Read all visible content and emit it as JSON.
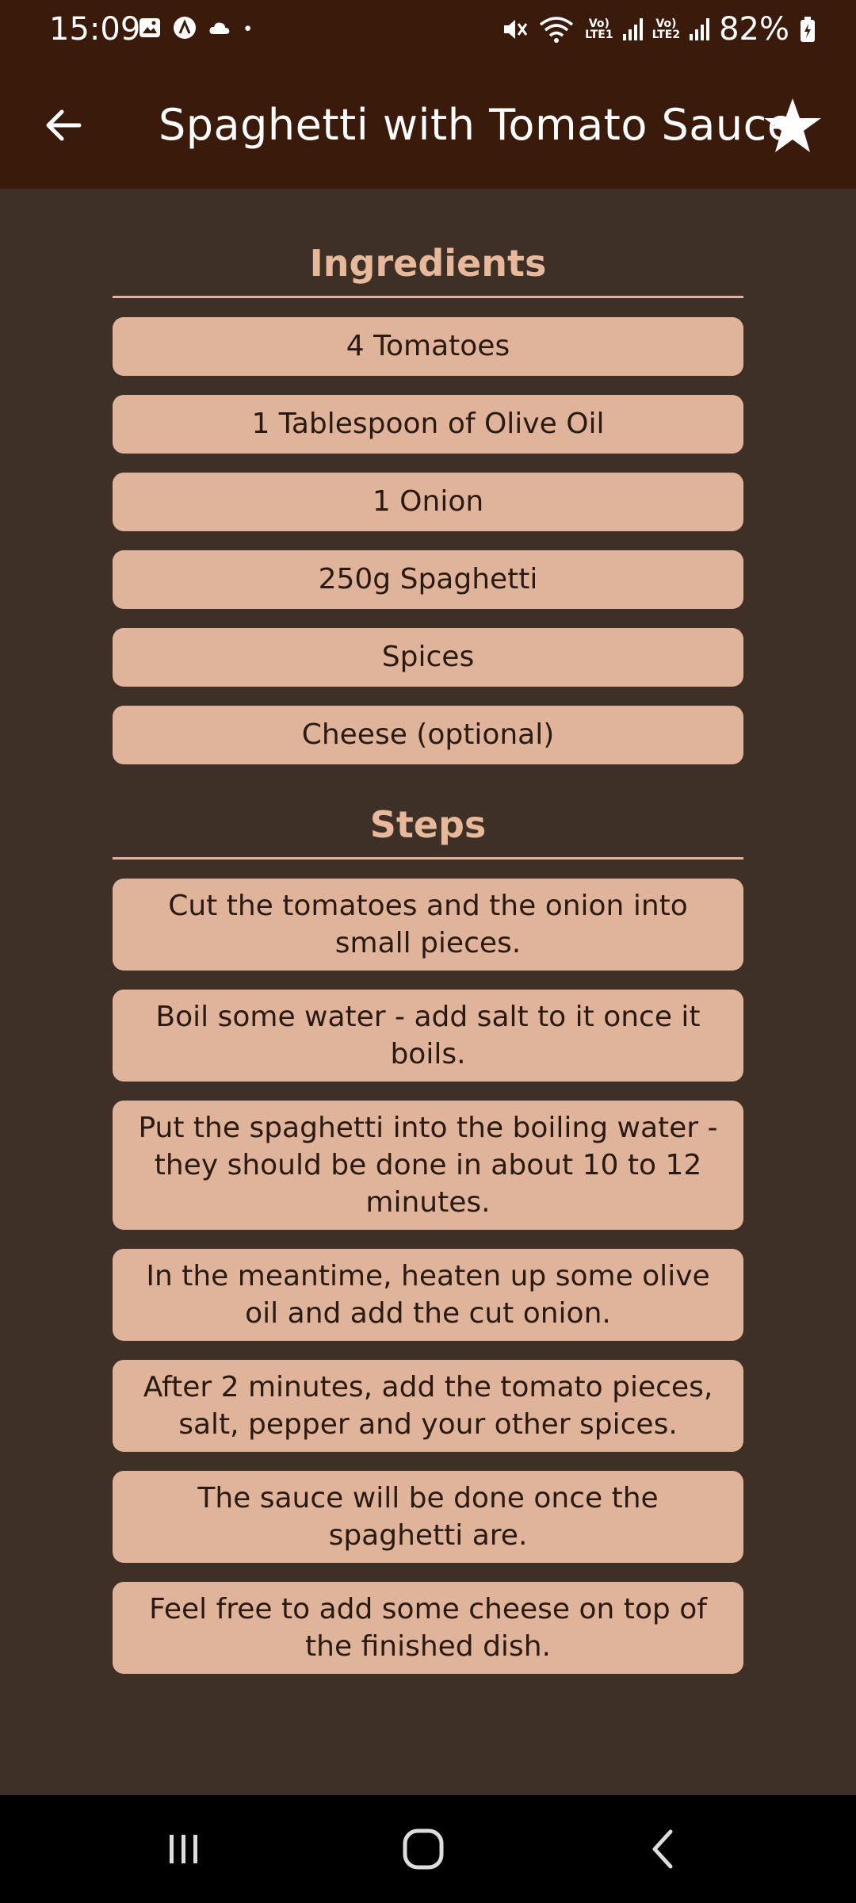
{
  "status_bar": {
    "time": "15:09",
    "battery": "82%",
    "net1": [
      "Vo)",
      "LTE1"
    ],
    "net2": [
      "Vo)",
      "LTE2"
    ],
    "icons": [
      "image-icon",
      "app-a-icon",
      "cloud-icon",
      "dot-icon",
      "mute-icon",
      "wifi-icon",
      "signal-icon",
      "battery-icon"
    ]
  },
  "app_bar": {
    "title": "Spaghetti with Tomato Sauce",
    "back_icon": "back-arrow-icon",
    "favorite_icon": "star-icon"
  },
  "ingredients": {
    "title": "Ingredients",
    "items": [
      "4 Tomatoes",
      "1 Tablespoon of Olive Oil",
      "1 Onion",
      "250g Spaghetti",
      "Spices",
      "Cheese (optional)"
    ]
  },
  "steps": {
    "title": "Steps",
    "items": [
      "Cut the tomatoes and the onion into small pieces.",
      "Boil some water - add salt to it once it boils.",
      "Put the spaghetti into the boiling water - they should be done in about 10 to 12 minutes.",
      "In the meantime, heaten up some olive oil and add the cut onion.",
      "After 2 minutes, add the tomato pieces, salt, pepper and your other spices.",
      "The sauce will be done once the spaghetti are.",
      "Feel free to add some cheese on top of the finished dish."
    ]
  },
  "nav_bar": {
    "icons": [
      "recent-apps-icon",
      "home-icon",
      "back-icon"
    ]
  },
  "colors": {
    "app_bar": "#3a1a0a",
    "background": "#3e2f27",
    "card": "#e0b49a",
    "section_title": "#e8b89a"
  }
}
